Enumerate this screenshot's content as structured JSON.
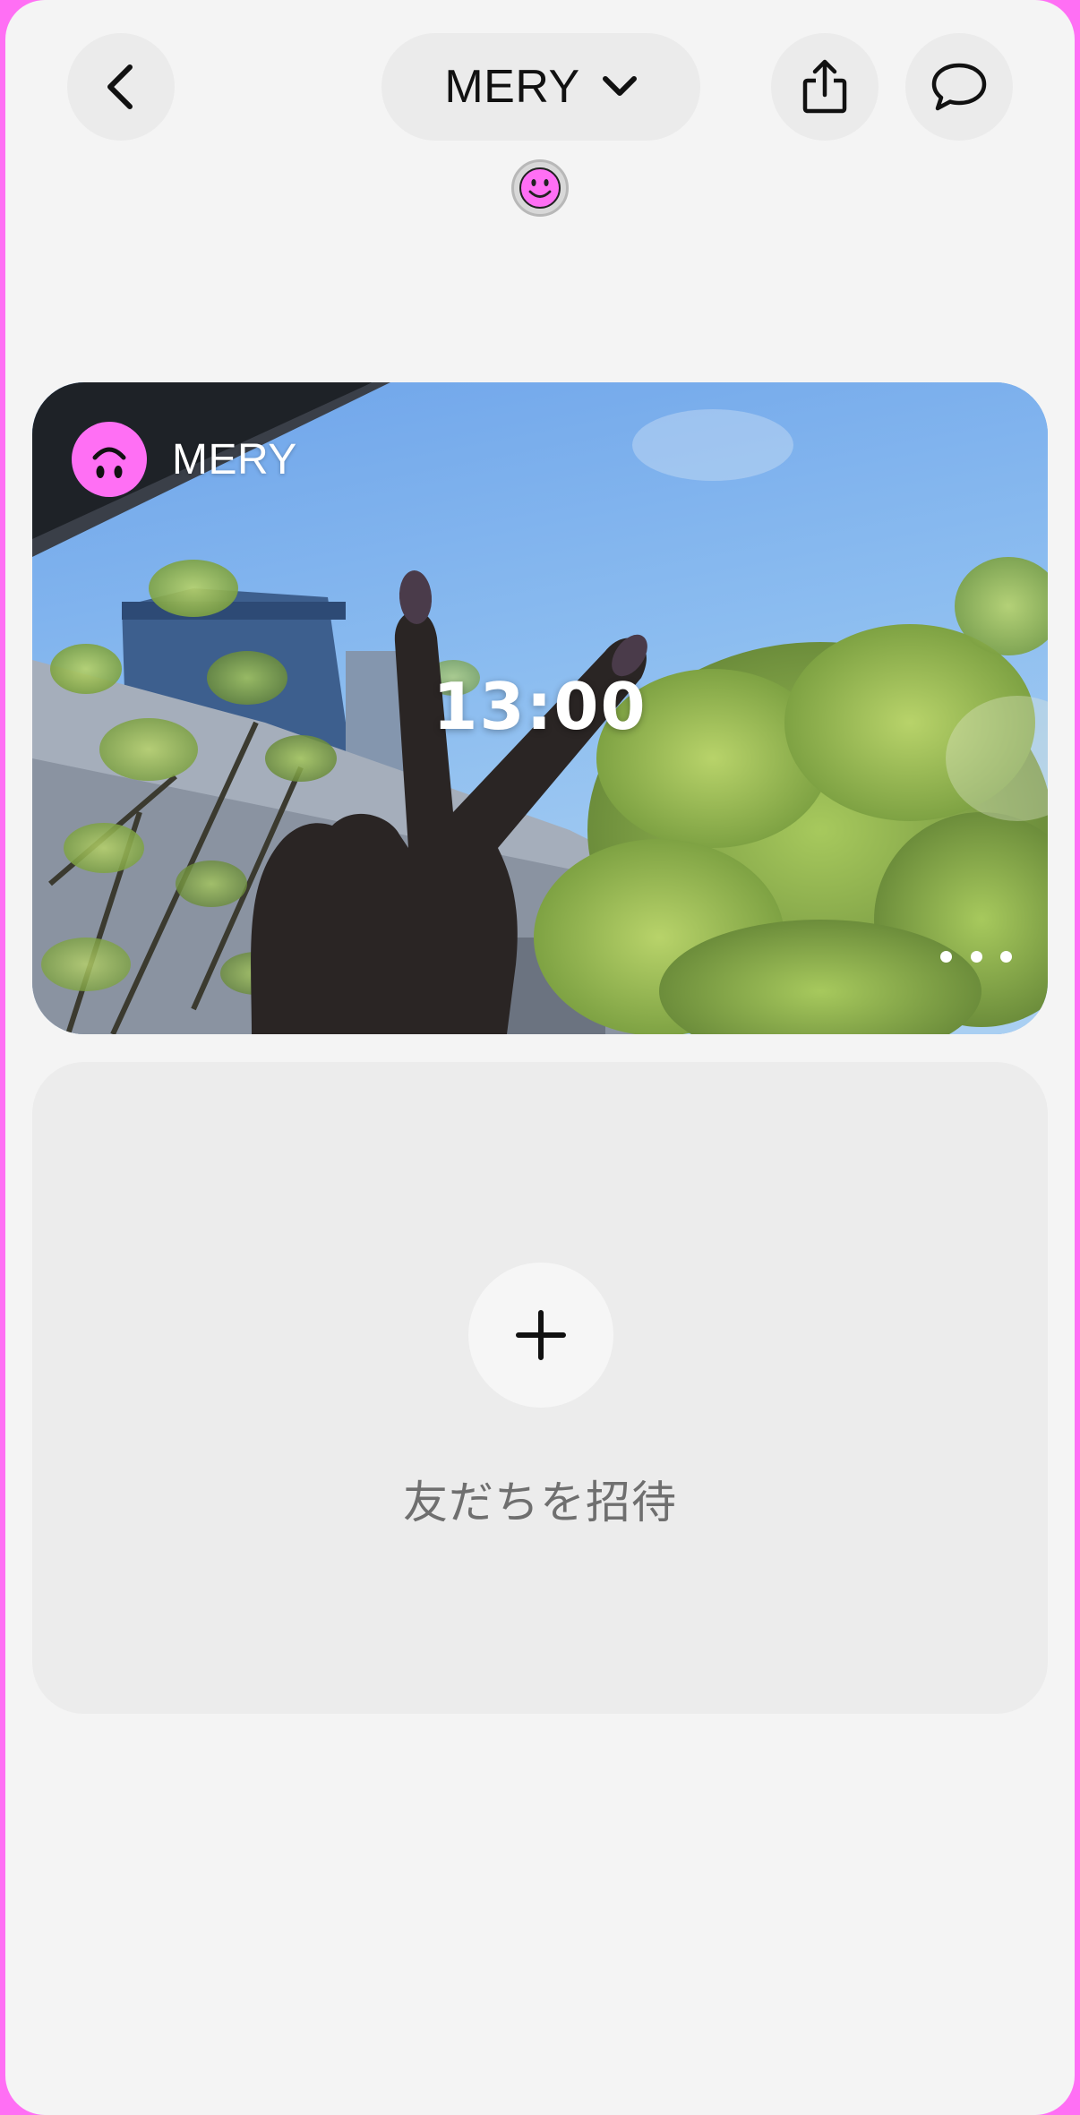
{
  "header": {
    "group_name": "MERY",
    "back_icon": "chevron-left-icon",
    "dropdown_icon": "chevron-down-icon",
    "share_icon": "share-icon",
    "chat_icon": "chat-bubble-icon",
    "member_avatar_icon": "smiley-face-icon"
  },
  "photo_card": {
    "username": "MERY",
    "time": "13:00",
    "avatar_icon": "upside-down-smiley-icon",
    "more_icon": "more-dots-icon"
  },
  "invite_card": {
    "label": "友だちを招待",
    "add_icon": "plus-icon"
  },
  "colors": {
    "accent_pink": "#ff6ff4",
    "background": "#f4f4f4",
    "button_gray": "#ebebeb",
    "card_gray": "#ececec",
    "label_gray": "#6f6f6f"
  }
}
